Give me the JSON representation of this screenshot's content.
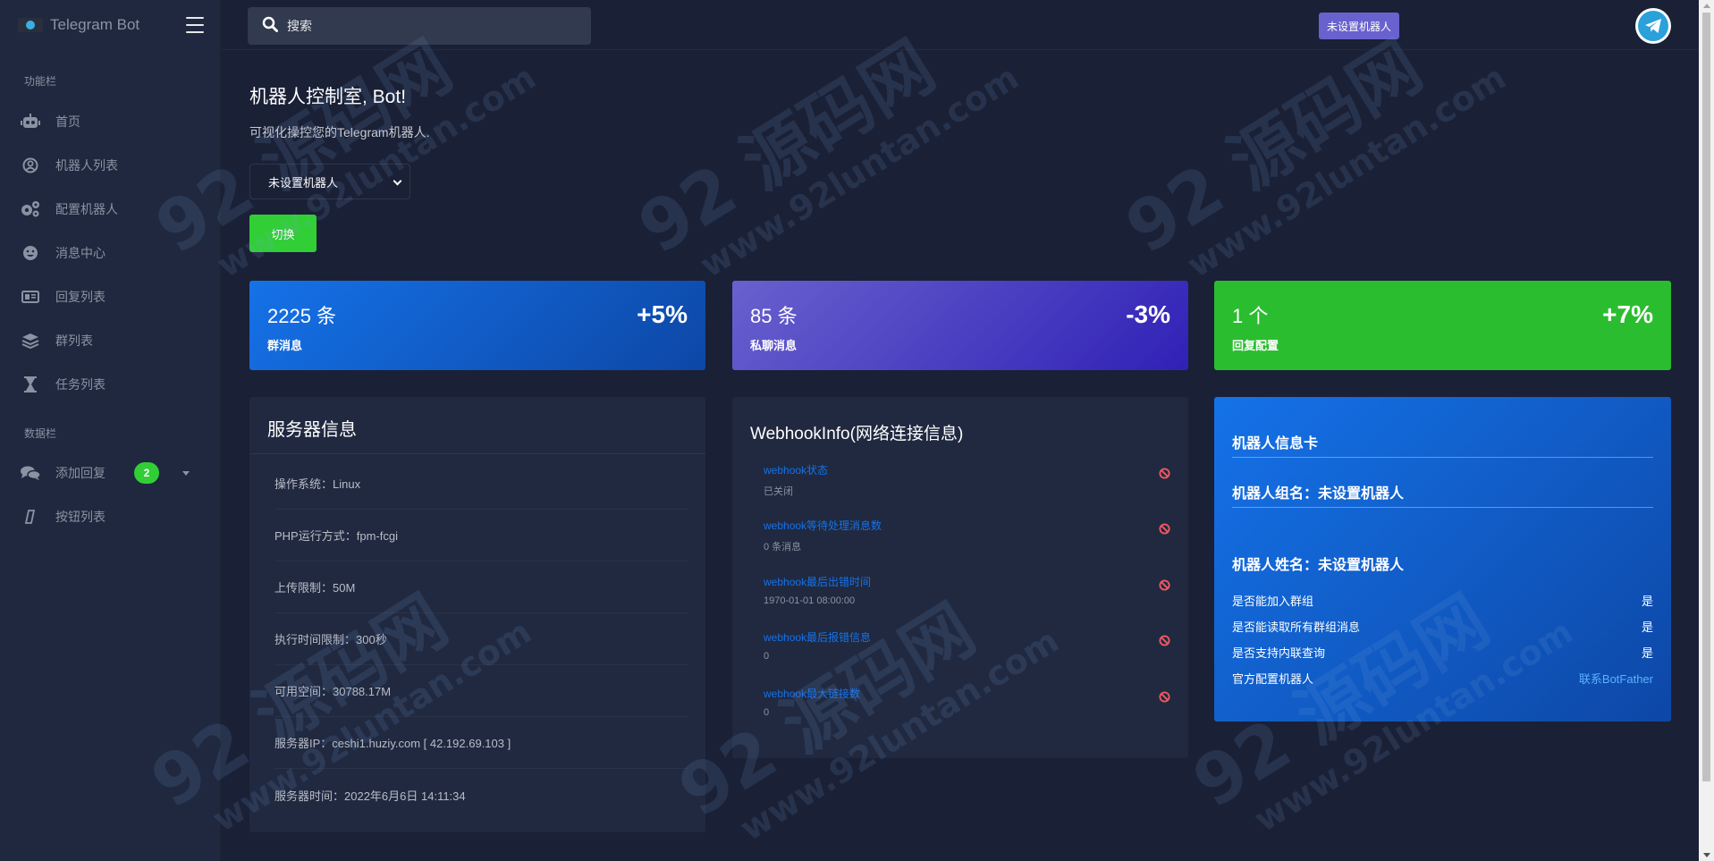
{
  "app": {
    "brand_title": "Telegram Bot"
  },
  "search": {
    "placeholder": "搜索"
  },
  "topbar": {
    "tag_label": "未设置机器人"
  },
  "sidebar": {
    "section_main": "功能栏",
    "items": [
      {
        "label": "首页",
        "icon": "robot-icon"
      },
      {
        "label": "机器人列表",
        "icon": "user-circle-icon"
      },
      {
        "label": "配置机器人",
        "icon": "gears-icon"
      },
      {
        "label": "消息中心",
        "icon": "smile-icon"
      },
      {
        "label": "回复列表",
        "icon": "id-card-icon"
      },
      {
        "label": "群列表",
        "icon": "layers-icon"
      },
      {
        "label": "任务列表",
        "icon": "hourglass-icon"
      }
    ],
    "section_data": "数据栏",
    "data_items": [
      {
        "label": "添加回复",
        "icon": "comments-icon",
        "badge": "2"
      },
      {
        "label": "按钮列表",
        "icon": "pencil-icon"
      }
    ]
  },
  "main": {
    "title": "机器人控制室, Bot!",
    "subtitle": "可视化操控您的Telegram机器人.",
    "select_value": "未设置机器人",
    "switch_label": "切换"
  },
  "stats": [
    {
      "value": "2225 条",
      "label": "群消息",
      "change": "+5%"
    },
    {
      "value": "85 条",
      "label": "私聊消息",
      "change": "-3%"
    },
    {
      "value": "1 个",
      "label": "回复配置",
      "change": "+7%"
    }
  ],
  "server": {
    "title": "服务器信息",
    "rows": [
      "操作系统：Linux",
      "PHP运行方式：fpm-fcgi",
      "上传限制：50M",
      "执行时间限制：300秒",
      "可用空间：30788.17M",
      "服务器IP：ceshi1.huziy.com [ 42.192.69.103 ]",
      "服务器时间：2022年6月6日 14:11:34"
    ]
  },
  "webhook": {
    "title": "WebhookInfo(网络连接信息)",
    "items": [
      {
        "key": "webhook状态",
        "value": "已关闭"
      },
      {
        "key": "webhook等待处理消息数",
        "value": "0 条消息"
      },
      {
        "key": "webhook最后出错时间",
        "value": "1970-01-01 08:00:00"
      },
      {
        "key": "webhook最后报错信息",
        "value": "0"
      },
      {
        "key": "webhook最大链接数",
        "value": "0"
      }
    ]
  },
  "bot_card": {
    "title": "机器人信息卡",
    "group_name": "机器人组名：未设置机器人",
    "bot_name": "机器人姓名：未设置机器人",
    "rows": [
      {
        "label": "是否能加入群组",
        "value": "是"
      },
      {
        "label": "是否能读取所有群组消息",
        "value": "是"
      },
      {
        "label": "是否支持内联查询",
        "value": "是"
      },
      {
        "label": "官方配置机器人",
        "value": "联系BotFather"
      }
    ]
  },
  "watermark": {
    "brand": "92 源码网",
    "url": "www.92luntan.com"
  },
  "colors": {
    "bg": "#1a2035",
    "sidebar": "#1f283e",
    "card": "#202940",
    "primary": "#1572e8",
    "secondary": "#6861ce",
    "success": "#31ce36",
    "danger": "#f25961"
  }
}
